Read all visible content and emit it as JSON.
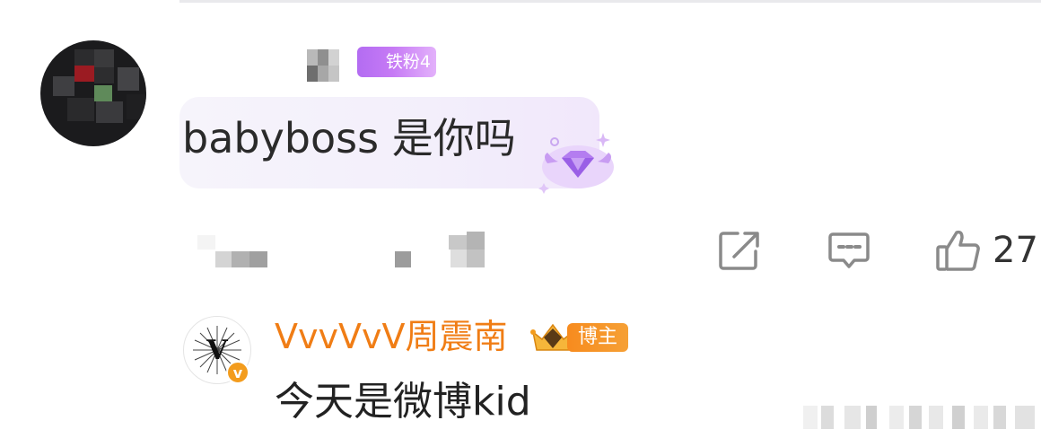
{
  "comment": {
    "fan_badge": "铁粉4",
    "text": "babyboss 是你吗",
    "actions": {
      "share_icon": "share-square-icon",
      "reply_icon": "comment-bubble-icon",
      "like_icon": "thumbs-up-icon",
      "like_count": "27"
    }
  },
  "reply": {
    "author": "VvvVvV周震南",
    "author_badge": "博主",
    "avatar_letter": "V",
    "verified_mark": "v",
    "text": "今天是微博kid"
  },
  "colors": {
    "fan_badge": "#b36cf2",
    "author_name": "#f07d15",
    "author_badge": "#f78b1e",
    "icon_gray": "#8a8a8a"
  }
}
